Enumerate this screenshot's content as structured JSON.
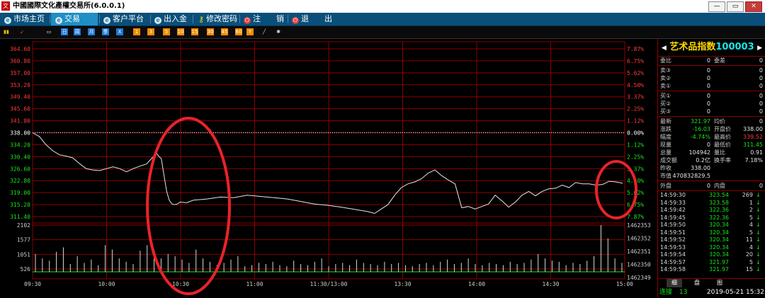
{
  "window": {
    "title": "中國國際文化產權交易所(6.0.0.1)",
    "logo_text": "文"
  },
  "menu": [
    {
      "label": "市场主页",
      "icon": "home-icon"
    },
    {
      "label": "交易",
      "icon": "trade-icon"
    },
    {
      "label": "客户平台",
      "icon": "client-icon"
    },
    {
      "label": "出入金",
      "icon": "funds-icon"
    },
    {
      "label": "修改密码",
      "icon": "key-icon"
    },
    {
      "label": "注　　销",
      "icon": "logout-icon"
    },
    {
      "label": "退　　出",
      "icon": "exit-icon"
    }
  ],
  "toolbar": [
    {
      "label": "▮▮",
      "icon": "bar-chart-icon",
      "color": "#f0c000"
    },
    {
      "label": "↙",
      "icon": "line-chart-icon",
      "color": "#e04040"
    },
    {
      "label": "▭",
      "icon": "window-icon",
      "color": "#ffffff"
    },
    {
      "label": "日",
      "icon": "daily-icon",
      "color": "#1e78d6"
    },
    {
      "label": "周",
      "icon": "weekly-icon",
      "color": "#1e78d6"
    },
    {
      "label": "月",
      "icon": "monthly-icon",
      "color": "#1e78d6"
    },
    {
      "label": "季",
      "icon": "quarterly-icon",
      "color": "#1e78d6"
    },
    {
      "label": "X",
      "icon": "close-period-icon",
      "color": "#1e78d6"
    },
    {
      "label": "1",
      "icon": "minute-1-icon",
      "color": "#f08c00"
    },
    {
      "label": "3",
      "icon": "minute-3-icon",
      "color": "#f08c00"
    },
    {
      "label": "5",
      "icon": "minute-5-icon",
      "color": "#f08c00"
    },
    {
      "label": "10",
      "icon": "minute-10-icon",
      "color": "#f08c00"
    },
    {
      "label": "15",
      "icon": "minute-15-icon",
      "color": "#f08c00"
    },
    {
      "label": "30",
      "icon": "minute-30-icon",
      "color": "#f08c00"
    },
    {
      "label": "45",
      "icon": "minute-45-icon",
      "color": "#f08c00"
    },
    {
      "label": "60",
      "icon": "minute-60-icon",
      "color": "#f08c00"
    },
    {
      "label": "Y",
      "icon": "year-icon",
      "color": "#f08c00"
    },
    {
      "label": "╱",
      "icon": "draw-line-icon",
      "color": "#dddddd"
    },
    {
      "label": "✱",
      "icon": "settings-icon",
      "color": "#dddddd"
    }
  ],
  "chart_data": {
    "type": "line",
    "x_ticks": [
      "09:30",
      "10:00",
      "10:30",
      "11:00",
      "11:30/13:00",
      "13:30",
      "14:00",
      "14:30",
      "15:00"
    ],
    "y_price_ticks": [
      "364.60",
      "360.80",
      "357.00",
      "353.20",
      "349.40",
      "345.60",
      "341.80",
      "338.00",
      "334.20",
      "330.40",
      "326.60",
      "322.80",
      "319.00",
      "315.20",
      "311.40"
    ],
    "y_percent_ticks": [
      "7.87%",
      "6.75%",
      "5.62%",
      "4.50%",
      "3.37%",
      "2.25%",
      "1.12%",
      "0.00%",
      "1.12%",
      "2.25%",
      "3.37%",
      "4.50%",
      "5.62%",
      "6.75%",
      "7.87%"
    ],
    "y_volume_ticks": [
      "2102",
      "1577",
      "1051",
      "526"
    ],
    "y_volume_right_ticks": [
      "1462353",
      "1462352",
      "1462351",
      "1462350",
      "1462349"
    ],
    "ylim": [
      311.4,
      364.6
    ],
    "reference_price": 338.0,
    "series": [
      {
        "x": [
          0,
          5,
          10,
          15,
          20,
          25,
          30,
          35,
          40,
          45,
          50,
          55,
          60,
          65,
          70,
          75,
          80,
          85,
          90,
          92,
          94,
          96,
          98,
          100,
          102,
          104,
          106,
          108,
          110,
          115,
          120,
          130,
          140,
          150,
          160,
          170,
          180,
          190,
          200,
          210,
          220,
          230,
          240,
          250,
          255,
          260,
          265,
          270,
          275,
          280,
          285,
          290,
          295,
          300,
          305,
          310,
          315,
          320,
          325,
          330,
          335,
          340,
          345,
          350,
          355,
          360,
          365,
          370,
          375,
          380,
          385,
          390,
          395,
          400,
          405,
          410,
          415,
          420,
          425,
          430,
          435,
          440
        ],
        "values": [
          338.0,
          336.8,
          334.2,
          332.3,
          331.0,
          330.6,
          330.0,
          328.2,
          326.6,
          326.2,
          326.0,
          326.6,
          327.2,
          326.6,
          325.6,
          326.6,
          327.4,
          328.1,
          330.4,
          331.8,
          330.5,
          329.8,
          324.5,
          319.4,
          316.5,
          315.4,
          315.2,
          315.4,
          316.0,
          315.8,
          316.6,
          317.0,
          317.6,
          317.4,
          318.2,
          317.8,
          317.4,
          317.0,
          316.2,
          315.4,
          315.0,
          314.4,
          313.7,
          313.0,
          312.4,
          313.8,
          315.2,
          318.2,
          320.6,
          321.8,
          322.4,
          323.4,
          325.2,
          326.2,
          324.4,
          323.0,
          321.8,
          314.2,
          314.6,
          313.8,
          314.6,
          315.4,
          318.2,
          316.4,
          314.4,
          316.0,
          318.2,
          319.4,
          318.0,
          319.4,
          320.2,
          320.4,
          321.4,
          320.6,
          322.2,
          321.8,
          321.8,
          321.4,
          321.6,
          322.6,
          322.4,
          321.97
        ]
      }
    ],
    "volume": [
      80,
      60,
      50,
      90,
      110,
      35,
      70,
      40,
      55,
      30,
      120,
      100,
      60,
      45,
      35,
      95,
      120,
      90,
      60,
      80,
      70,
      55,
      40,
      100,
      60,
      45,
      30,
      40,
      55,
      70,
      25,
      30,
      40,
      35,
      45,
      30,
      25,
      50,
      35,
      30,
      45,
      60,
      25,
      35,
      40,
      30,
      55,
      40,
      35,
      30,
      45,
      35,
      40,
      30,
      25,
      35,
      40,
      30,
      45,
      55,
      35,
      40,
      60,
      35,
      30,
      40,
      35,
      30,
      45,
      35,
      40,
      55,
      80,
      60,
      50,
      45,
      30,
      40,
      35,
      50,
      70,
      210,
      150,
      60,
      40
    ],
    "grid": true
  },
  "panel": {
    "name": "艺术品指数",
    "code": "100003",
    "commission": [
      {
        "label": "委比",
        "value": "0",
        "label2": "委差",
        "value2": "0"
      }
    ],
    "asks": [
      {
        "label": "卖③",
        "value": "0",
        "value2": "0"
      },
      {
        "label": "卖②",
        "value": "0",
        "value2": "0"
      },
      {
        "label": "卖①",
        "value": "0",
        "value2": "0"
      }
    ],
    "bids": [
      {
        "label": "买①",
        "value": "0",
        "value2": "0"
      },
      {
        "label": "买②",
        "value": "0",
        "value2": "0"
      },
      {
        "label": "买③",
        "value": "0",
        "value2": "0"
      }
    ],
    "stats": [
      {
        "label": "最新",
        "value": "321.97",
        "label2": "均价",
        "value2": "0",
        "c1": "green",
        "c2": "white"
      },
      {
        "label": "涨跌",
        "value": "-16.03",
        "label2": "开盘价",
        "value2": "338.00",
        "c1": "green",
        "c2": "white"
      },
      {
        "label": "幅度",
        "value": "-4.74%",
        "label2": "最高价",
        "value2": "339.52",
        "c1": "green",
        "c2": "red"
      },
      {
        "label": "现量",
        "value": "0",
        "label2": "最低价",
        "value2": "311.45",
        "c1": "white",
        "c2": "green"
      },
      {
        "label": "总量",
        "value": "104942",
        "label2": "量比",
        "value2": "0.91",
        "c1": "white",
        "c2": "white"
      },
      {
        "label": "成交额",
        "value": "0.2亿",
        "label2": "换手率",
        "value2": "7.18%",
        "c1": "white",
        "c2": "white"
      },
      {
        "label": "昨收",
        "value": "338.00",
        "label2": "",
        "value2": "",
        "c1": "white",
        "c2": "white"
      },
      {
        "label": "市值",
        "value": "470832829.5",
        "label2": "",
        "value2": "",
        "c1": "white",
        "c2": "white"
      }
    ],
    "outer": {
      "label": "外盘",
      "value": "0",
      "label2": "内盘",
      "value2": "0"
    },
    "ticks": [
      {
        "time": "14:59:30",
        "price": "323.54",
        "volume": "269"
      },
      {
        "time": "14:59:33",
        "price": "323.58",
        "volume": "1"
      },
      {
        "time": "14:59:42",
        "price": "322.36",
        "volume": "2"
      },
      {
        "time": "14:59:45",
        "price": "322.36",
        "volume": "5"
      },
      {
        "time": "14:59:50",
        "price": "320.34",
        "volume": "4"
      },
      {
        "time": "14:59:51",
        "price": "320.34",
        "volume": "5"
      },
      {
        "time": "14:59:52",
        "price": "320.34",
        "volume": "11"
      },
      {
        "time": "14:59:53",
        "price": "320.34",
        "volume": "4"
      },
      {
        "time": "14:59:54",
        "price": "320.34",
        "volume": "20"
      },
      {
        "time": "14:59:57",
        "price": "321.97",
        "volume": "5"
      },
      {
        "time": "14:59:58",
        "price": "321.97",
        "volume": "15"
      }
    ],
    "tabs": [
      "细",
      "盘",
      "图"
    ],
    "status": {
      "label": "连接",
      "count": "13",
      "datetime": "2019-05-21 15:32"
    }
  },
  "colors": {
    "grid": "#8b0000",
    "axis_red": "#ff3c3c",
    "axis_green": "#17e817",
    "price_line": "#e6e6e6",
    "volume_bar": "#d8d8d8",
    "volume_base": "#17e817",
    "annotation": "#e8232a"
  }
}
